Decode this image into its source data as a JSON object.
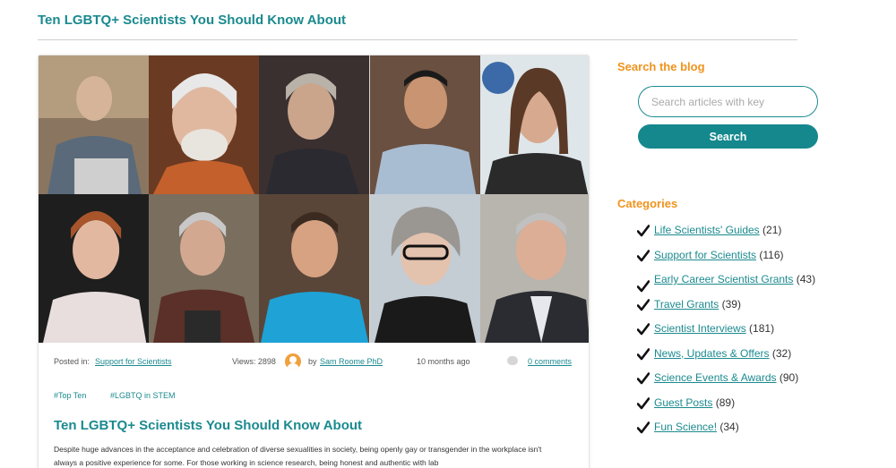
{
  "header": {
    "title": "Ten LGBTQ+ Scientists You Should Know About"
  },
  "post": {
    "meta": {
      "posted_in_label": "Posted in:",
      "category": "Support for Scientists",
      "views": "Views: 2898",
      "by_label": "by",
      "author": "Sam Roome PhD",
      "time": "10 months ago",
      "comments": "0 comments"
    },
    "tags": [
      "#Top Ten",
      "#LGBTQ in STEM"
    ],
    "title": "Ten LGBTQ+ Scientists You Should Know About",
    "excerpt": "Despite huge advances in the acceptance and celebration of diverse sexualities in society, being openly gay or transgender in the workplace isn't always a positive experience for some. For those working in science research, being honest and authentic with lab"
  },
  "sidebar": {
    "search": {
      "heading": "Search the blog",
      "placeholder": "Search articles with key",
      "button_label": "Search"
    },
    "categories": {
      "heading": "Categories",
      "items": [
        {
          "label": "Life Scientists' Guides",
          "count": "(21)"
        },
        {
          "label": "Support for Scientists",
          "count": "(116)"
        },
        {
          "label": "Early Career Scientist Grants",
          "count": "(43)"
        },
        {
          "label": "Travel Grants",
          "count": "(39)"
        },
        {
          "label": "Scientist Interviews",
          "count": "(181)"
        },
        {
          "label": "News, Updates & Offers",
          "count": "(32)"
        },
        {
          "label": "Science Events & Awards",
          "count": "(90)"
        },
        {
          "label": "Guest Posts",
          "count": "(89)"
        },
        {
          "label": "Fun Science!",
          "count": "(34)"
        }
      ]
    }
  },
  "colors": {
    "accent": "#1b8a8f",
    "heading_orange": "#f0931c",
    "button": "#15888d"
  }
}
